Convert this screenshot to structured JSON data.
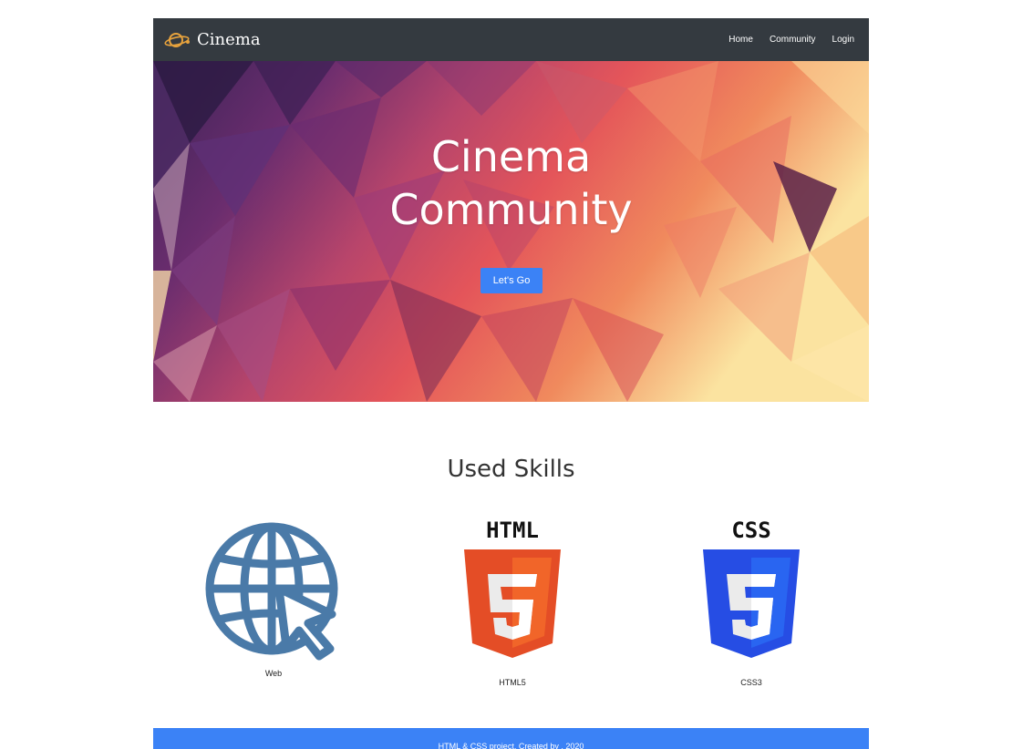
{
  "navbar": {
    "brand": "Cinema",
    "links": [
      "Home",
      "Community",
      "Login"
    ]
  },
  "hero": {
    "title_line1": "Cinema",
    "title_line2": "Community",
    "button": "Let's Go"
  },
  "skills": {
    "heading": "Used Skills",
    "items": [
      {
        "label": "Web",
        "icon": "globe-cursor-icon"
      },
      {
        "label": "HTML5",
        "icon": "html5-icon",
        "caption": "HTML"
      },
      {
        "label": "CSS3",
        "icon": "css3-icon",
        "caption": "CSS"
      }
    ]
  },
  "footer": {
    "text": "HTML & CSS project. Created by        , 2020"
  },
  "colors": {
    "navbar": "#343a40",
    "accent": "#3b82f6",
    "web_icon": "#4a7aa8",
    "html_orange": "#e44d26",
    "css_blue": "#264de4"
  }
}
